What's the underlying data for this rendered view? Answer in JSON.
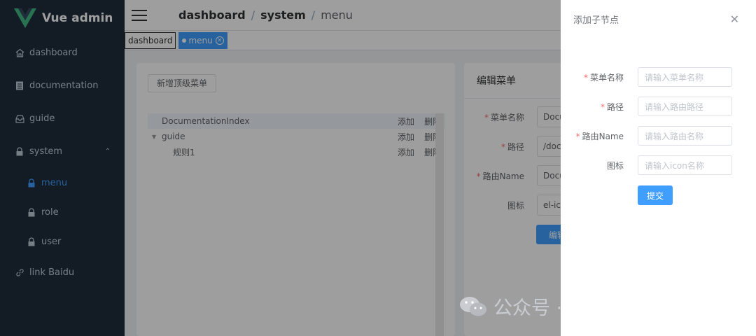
{
  "app": {
    "title": "Vue admin"
  },
  "sidebar": {
    "items": [
      {
        "label": "dashboard",
        "icon": "home-icon"
      },
      {
        "label": "documentation",
        "icon": "document-icon"
      },
      {
        "label": "guide",
        "icon": "inbox-icon"
      },
      {
        "label": "system",
        "icon": "lock-icon"
      },
      {
        "label": "menu",
        "icon": "lock-icon"
      },
      {
        "label": "role",
        "icon": "lock-icon"
      },
      {
        "label": "user",
        "icon": "lock-icon"
      },
      {
        "label": "link Baidu",
        "icon": "link-icon"
      }
    ]
  },
  "breadcrumb": {
    "items": [
      "dashboard",
      "system",
      "menu"
    ],
    "separator": "/"
  },
  "tags": [
    {
      "label": "dashboard"
    },
    {
      "label": "menu",
      "active": true
    }
  ],
  "left_card": {
    "add_top_button": "新增顶级菜单",
    "tree": [
      {
        "label": "DocumentationIndex",
        "add": "添加",
        "delete": "删除"
      },
      {
        "label": "guide",
        "add": "添加",
        "delete": "删除"
      },
      {
        "label": "规则1",
        "add": "添加",
        "delete": "删除"
      }
    ]
  },
  "right_card": {
    "title": "编辑菜单",
    "fields": [
      {
        "label": "菜单名称",
        "value": "Docu",
        "required": true
      },
      {
        "label": "路径",
        "value": "/doc",
        "required": true
      },
      {
        "label": "路由Name",
        "value": "Docu",
        "required": true
      },
      {
        "label": "图标",
        "value": "el-ico",
        "required": false
      }
    ],
    "submit_label": "编辑"
  },
  "drawer": {
    "title": "添加子节点",
    "fields": [
      {
        "label": "菜单名称",
        "placeholder": "请输入菜单名称",
        "required": true
      },
      {
        "label": "路径",
        "placeholder": "请输入路由路径",
        "required": true
      },
      {
        "label": "路由Name",
        "placeholder": "请输入路由名称",
        "required": true
      },
      {
        "label": "图标",
        "placeholder": "请输入icon名称",
        "required": false
      }
    ],
    "submit_label": "提交"
  },
  "watermark": {
    "text": "公众号 · 千言万语一只猿"
  },
  "colors": {
    "sidebar_bg": "#1f2d3d",
    "accent": "#409eff",
    "required": "#f56c6c"
  }
}
